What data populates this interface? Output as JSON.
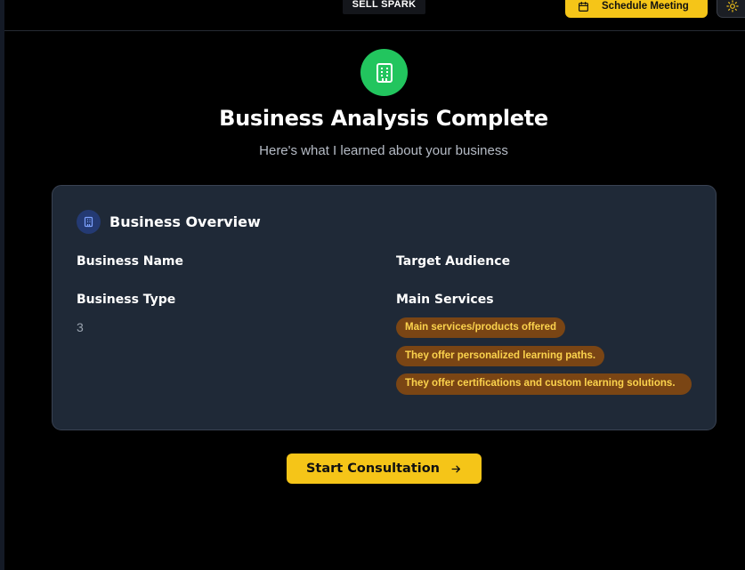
{
  "header": {
    "logo_text": "SELL SPARK",
    "schedule_label": "Schedule Meeting"
  },
  "hero": {
    "title": "Business Analysis Complete",
    "subtitle": "Here's what I learned about your business"
  },
  "overview": {
    "title": "Business Overview",
    "business_name_label": "Business Name",
    "business_type_label": "Business Type",
    "business_type_value": "3",
    "target_audience_label": "Target Audience",
    "main_services_label": "Main Services",
    "services": [
      "Main services/products offered",
      "They offer personalized learning paths.",
      "They offer certifications and custom learning solutions."
    ]
  },
  "actions": {
    "start_label": "Start Consultation"
  },
  "colors": {
    "accent": "#f5c518",
    "success": "#22c55e",
    "card_bg": "#1f2937",
    "tag_bg": "#7a4514",
    "tag_text": "#fcd34d"
  },
  "icons": {
    "calendar": "calendar-icon",
    "theme": "sun-icon",
    "building": "building-icon",
    "arrow": "arrow-right-icon"
  }
}
